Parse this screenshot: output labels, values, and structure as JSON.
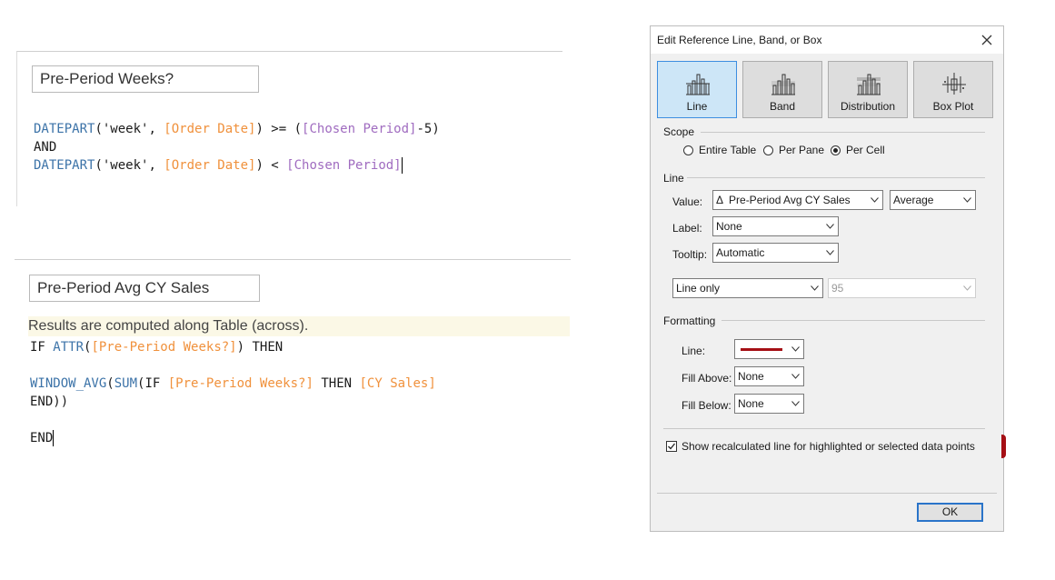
{
  "calc1": {
    "name": "Pre-Period Weeks?",
    "code": [
      [
        {
          "t": "DATEPART",
          "c": "fn"
        },
        {
          "t": "('week', "
        },
        {
          "t": "[Order Date]",
          "c": "field"
        },
        {
          "t": ") >= ("
        },
        {
          "t": "[Chosen Period]",
          "c": "param"
        },
        {
          "t": "-5)"
        }
      ],
      [
        {
          "t": "AND"
        }
      ],
      [
        {
          "t": "DATEPART",
          "c": "fn"
        },
        {
          "t": "('week', "
        },
        {
          "t": "[Order Date]",
          "c": "field"
        },
        {
          "t": ") < "
        },
        {
          "t": "[Chosen Period]",
          "c": "param"
        },
        {
          "cursor": true
        }
      ]
    ]
  },
  "calc2": {
    "name": "Pre-Period Avg CY Sales",
    "banner": "Results are computed along Table (across).",
    "code": [
      [
        {
          "t": "IF "
        },
        {
          "t": "ATTR",
          "c": "fn"
        },
        {
          "t": "("
        },
        {
          "t": "[Pre-Period Weeks?]",
          "c": "field"
        },
        {
          "t": ") THEN"
        }
      ],
      [
        {
          "t": ""
        }
      ],
      [
        {
          "t": "WINDOW_AVG",
          "c": "fn"
        },
        {
          "t": "("
        },
        {
          "t": "SUM",
          "c": "fn"
        },
        {
          "t": "(IF "
        },
        {
          "t": "[Pre-Period Weeks?]",
          "c": "field"
        },
        {
          "t": " THEN "
        },
        {
          "t": "[CY Sales]",
          "c": "field"
        }
      ],
      [
        {
          "t": "END))"
        }
      ],
      [
        {
          "t": ""
        }
      ],
      [
        {
          "t": "END"
        },
        {
          "cursor": true
        }
      ]
    ]
  },
  "dialog": {
    "title": "Edit Reference Line, Band, or Box",
    "types": [
      {
        "label": "Line",
        "icon": "line-icon",
        "active": true
      },
      {
        "label": "Band",
        "icon": "band-icon",
        "active": false
      },
      {
        "label": "Distribution",
        "icon": "distribution-icon",
        "active": false
      },
      {
        "label": "Box Plot",
        "icon": "box-plot-icon",
        "active": false
      }
    ],
    "scope": {
      "heading": "Scope",
      "options": [
        {
          "label": "Entire Table",
          "selected": false
        },
        {
          "label": "Per Pane",
          "selected": false
        },
        {
          "label": "Per Cell",
          "selected": true
        }
      ]
    },
    "line": {
      "heading": "Line",
      "value_label": "Value:",
      "value_field": "Pre-Period Avg CY Sales",
      "value_field_icon": "Δ",
      "aggregation": "Average",
      "label_label": "Label:",
      "label_value": "None",
      "tooltip_label": "Tooltip:",
      "tooltip_value": "Automatic",
      "line_only": "Line only",
      "confidence": "95"
    },
    "formatting": {
      "heading": "Formatting",
      "line_label": "Line:",
      "line_color": "#a50f15",
      "fill_above_label": "Fill Above:",
      "fill_above_value": "None",
      "fill_below_label": "Fill Below:",
      "fill_below_value": "None"
    },
    "recalc_checkbox": {
      "label": "Show recalculated line for highlighted or selected data points",
      "checked": true
    },
    "ok_label": "OK"
  },
  "colors": {
    "function": "#3c73a8",
    "field": "#f0913c",
    "parameter": "#a06cc0",
    "accent": "#3d8ee0"
  }
}
